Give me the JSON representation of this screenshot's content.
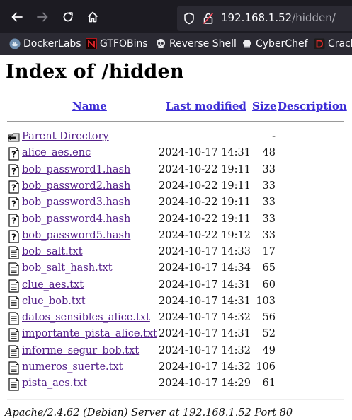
{
  "browser": {
    "url_host": "192.168.1.52",
    "url_path": "/hidden/",
    "bookmarks": [
      {
        "label": "DockerLabs",
        "icon": "dockerlabs-icon"
      },
      {
        "label": "GTFOBins",
        "icon": "gtfobins-icon"
      },
      {
        "label": "Reverse Shell",
        "icon": "skull-icon"
      },
      {
        "label": "CyberChef",
        "icon": "chef-hat-icon"
      },
      {
        "label": "Crack",
        "icon": "d-logo-icon"
      }
    ]
  },
  "page": {
    "title": "Index of /hidden",
    "columns": {
      "name": "Name",
      "last_modified": "Last modified",
      "size": "Size",
      "description": "Description"
    },
    "rows": [
      {
        "name": "Parent Directory",
        "date": "",
        "size": "-",
        "icon": "back-folder-icon"
      },
      {
        "name": "alice_aes.enc",
        "date": "2024-10-17 14:31",
        "size": "48",
        "icon": "unknown-file-icon"
      },
      {
        "name": "bob_password1.hash",
        "date": "2024-10-22 19:11",
        "size": "33",
        "icon": "unknown-file-icon"
      },
      {
        "name": "bob_password2.hash",
        "date": "2024-10-22 19:11",
        "size": "33",
        "icon": "unknown-file-icon"
      },
      {
        "name": "bob_password3.hash",
        "date": "2024-10-22 19:11",
        "size": "33",
        "icon": "unknown-file-icon"
      },
      {
        "name": "bob_password4.hash",
        "date": "2024-10-22 19:11",
        "size": "33",
        "icon": "unknown-file-icon"
      },
      {
        "name": "bob_password5.hash",
        "date": "2024-10-22 19:12",
        "size": "33",
        "icon": "unknown-file-icon"
      },
      {
        "name": "bob_salt.txt",
        "date": "2024-10-17 14:33",
        "size": "17",
        "icon": "text-file-icon"
      },
      {
        "name": "bob_salt_hash.txt",
        "date": "2024-10-17 14:34",
        "size": "65",
        "icon": "text-file-icon"
      },
      {
        "name": "clue_aes.txt",
        "date": "2024-10-17 14:31",
        "size": "60",
        "icon": "text-file-icon"
      },
      {
        "name": "clue_bob.txt",
        "date": "2024-10-17 14:31",
        "size": "103",
        "icon": "text-file-icon"
      },
      {
        "name": "datos_sensibles_alice.txt",
        "date": "2024-10-17 14:32",
        "size": "56",
        "icon": "text-file-icon"
      },
      {
        "name": "importante_pista_alice.txt",
        "date": "2024-10-17 14:31",
        "size": "52",
        "icon": "text-file-icon"
      },
      {
        "name": "informe_segur_bob.txt",
        "date": "2024-10-17 14:32",
        "size": "49",
        "icon": "text-file-icon"
      },
      {
        "name": "numeros_suerte.txt",
        "date": "2024-10-17 14:32",
        "size": "106",
        "icon": "text-file-icon"
      },
      {
        "name": "pista_aes.txt",
        "date": "2024-10-17 14:29",
        "size": "61",
        "icon": "text-file-icon"
      }
    ],
    "footer": "Apache/2.4.62 (Debian) Server at 192.168.1.52 Port 80"
  }
}
